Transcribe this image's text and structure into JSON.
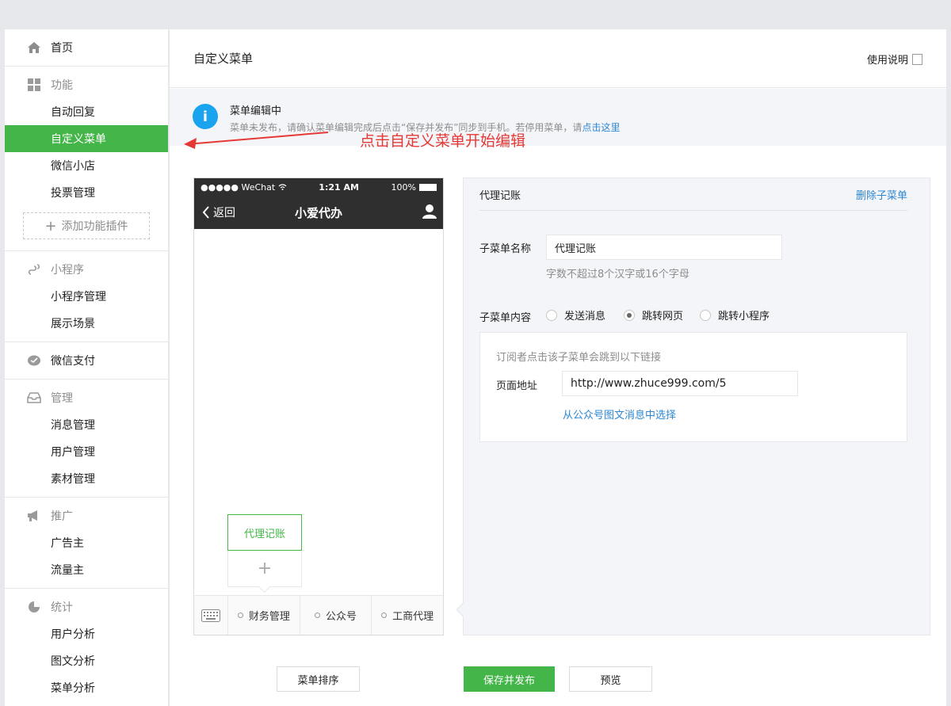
{
  "sidebar": {
    "home": "首页",
    "feature": {
      "title": "功能",
      "items": [
        "自动回复",
        "自定义菜单",
        "微信小店",
        "投票管理"
      ],
      "add_plugin": "添加功能插件"
    },
    "miniprogram": {
      "title": "小程序",
      "items": [
        "小程序管理",
        "展示场景"
      ]
    },
    "pay": "微信支付",
    "manage": {
      "title": "管理",
      "items": [
        "消息管理",
        "用户管理",
        "素材管理"
      ]
    },
    "promote": {
      "title": "推广",
      "items": [
        "广告主",
        "流量主"
      ]
    },
    "stats": {
      "title": "统计",
      "items": [
        "用户分析",
        "图文分析",
        "菜单分析"
      ]
    }
  },
  "header": {
    "title": "自定义菜单",
    "help": "使用说明"
  },
  "notice": {
    "title": "菜单编辑中",
    "desc": "菜单未发布，请确认菜单编辑完成后点击“保存并发布”同步到手机。若停用菜单，请",
    "link": "点击这里"
  },
  "annotation": "点击自定义菜单开始编辑",
  "phone": {
    "carrier": "●●●●● WeChat",
    "time": "1:21 AM",
    "battery": "100%",
    "back": "返回",
    "title": "小爱代办",
    "submenu_item": "代理记账",
    "submenu_add": "+",
    "menus": [
      "财务管理",
      "公众号",
      "工商代理"
    ]
  },
  "editor": {
    "title": "代理记账",
    "delete": "删除子菜单",
    "name_label": "子菜单名称",
    "name_value": "代理记账",
    "name_hint": "字数不超过8个汉字或16个字母",
    "content_label": "子菜单内容",
    "options": [
      "发送消息",
      "跳转网页",
      "跳转小程序"
    ],
    "selected_option": "跳转网页",
    "link_desc": "订阅者点击该子菜单会跳到以下链接",
    "url_label": "页面地址",
    "url_value": "http://www.zhuce999.com/5",
    "choose_link": "从公众号图文消息中选择"
  },
  "buttons": {
    "sort": "菜单排序",
    "save": "保存并发布",
    "preview": "预览"
  },
  "colors": {
    "accent": "#44b549",
    "link": "#2e87d3",
    "annotation": "#e53935"
  }
}
